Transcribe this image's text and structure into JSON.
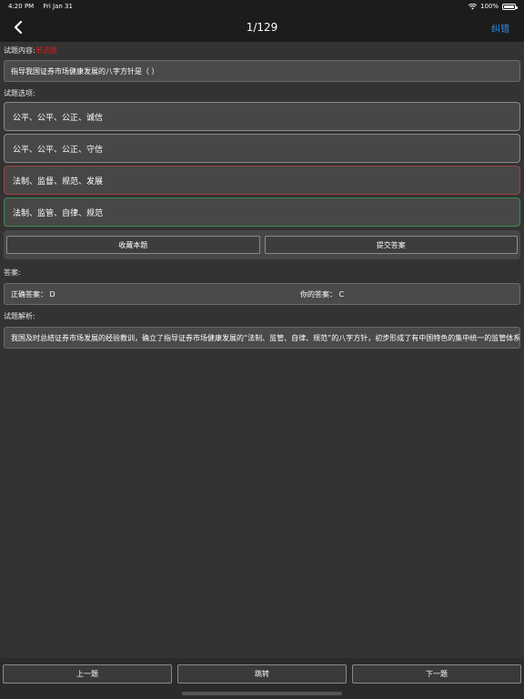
{
  "status": {
    "time": "4:20 PM",
    "date": "Fri Jan 31",
    "battery": "100%"
  },
  "nav": {
    "title": "1/129",
    "report_label": "纠错"
  },
  "question": {
    "label": "试题内容:",
    "type_tag": "单选题",
    "text": "指导我国证券市场健康发展的八字方针是（ ）"
  },
  "options": {
    "label": "试题选项:",
    "items": [
      {
        "text": "公平、公平、公正、诚信",
        "state": "normal"
      },
      {
        "text": "公平、公平、公正、守信",
        "state": "normal"
      },
      {
        "text": "法制、监督、规范、发展",
        "state": "wrong"
      },
      {
        "text": "法制、监管、自律、规范",
        "state": "correct"
      }
    ]
  },
  "actions": {
    "favorite_label": "收藏本题",
    "submit_label": "提交答案"
  },
  "answer": {
    "label": "答案:",
    "correct_text": "正确答案：  D",
    "yours_text": "你的答案：  C"
  },
  "analysis": {
    "label": "试题解析:",
    "text": "我国及时总结证券市场发展的经验教训，确立了指导证券市场健康发展的“法制、监管、自律、规范”的八字方针，初步形成了有中国特色的集中统一的监管体系"
  },
  "bottom": {
    "prev_label": "上一题",
    "jump_label": "跳转",
    "next_label": "下一题"
  },
  "colors": {
    "background": "#333333",
    "accent": "#2f8fe8",
    "tag_red": "#d81e1e",
    "wrong_border": "#a04040",
    "correct_border": "#3e8a4e"
  }
}
